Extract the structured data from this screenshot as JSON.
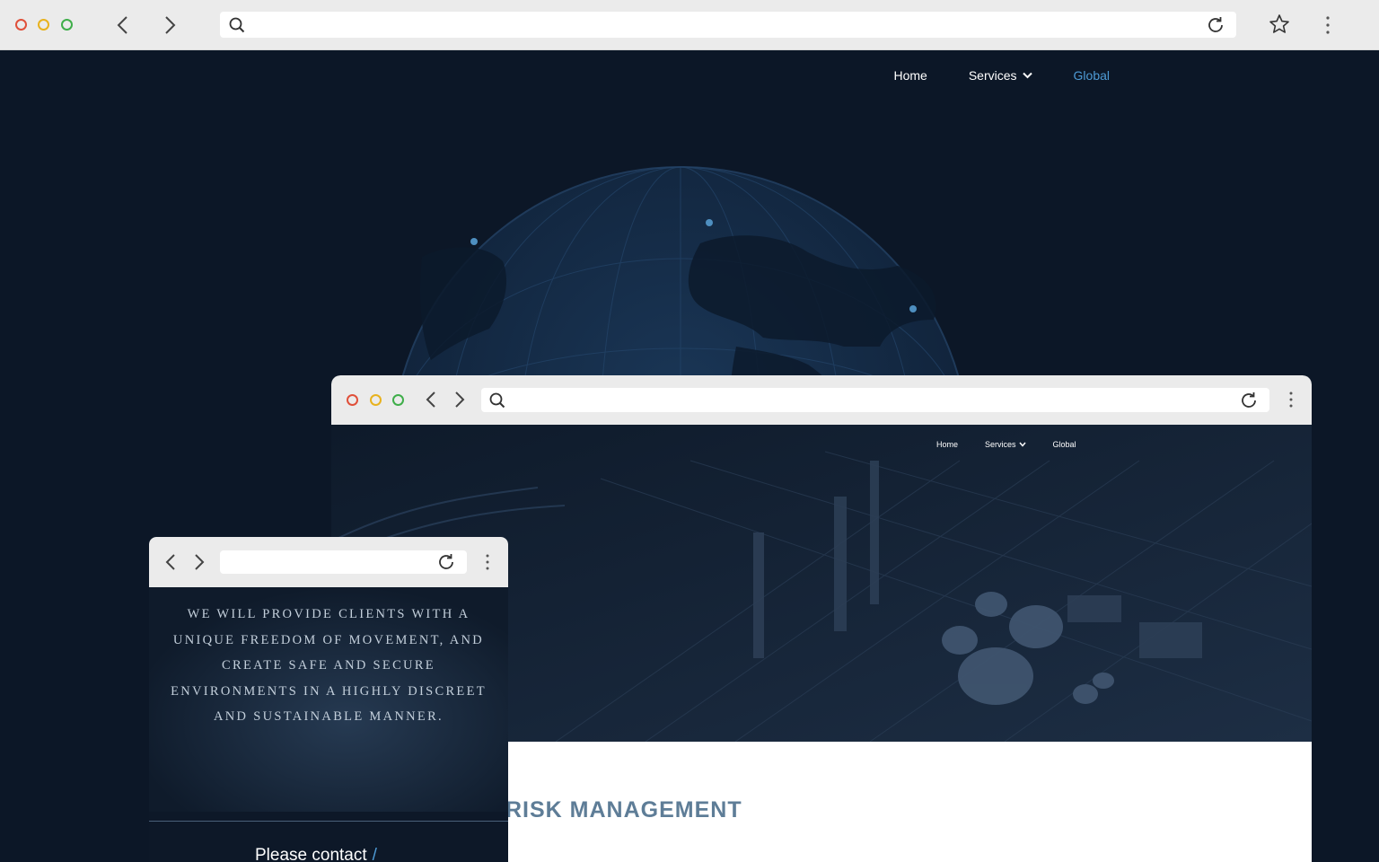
{
  "main_window": {
    "nav": {
      "home": "Home",
      "services": "Services",
      "global": "Global"
    }
  },
  "mid_window": {
    "nav": {
      "home": "Home",
      "services": "Services",
      "global": "Global"
    },
    "section_title": "RISK MANAGEMENT"
  },
  "small_window": {
    "mission": "WE WILL PROVIDE CLIENTS WITH A UNIQUE FREEDOM OF MOVEMENT, AND CREATE SAFE AND SECURE ENVIRONMENTS IN A HIGHLY DISCREET AND SUSTAINABLE MANNER.",
    "contact": "Please contact",
    "contact_slash": "/"
  },
  "colors": {
    "page_bg": "#0c1727",
    "chrome_bg": "#ebebeb",
    "nav_active": "#4e9bd6",
    "heading": "#5e7d97",
    "dot_red": "#e0503a",
    "dot_yellow": "#e8b21e",
    "dot_green": "#3fae4a"
  },
  "icons": [
    "back-icon",
    "forward-icon",
    "search-icon",
    "reload-icon",
    "star-icon",
    "menu-icon",
    "chevron-down-icon"
  ]
}
